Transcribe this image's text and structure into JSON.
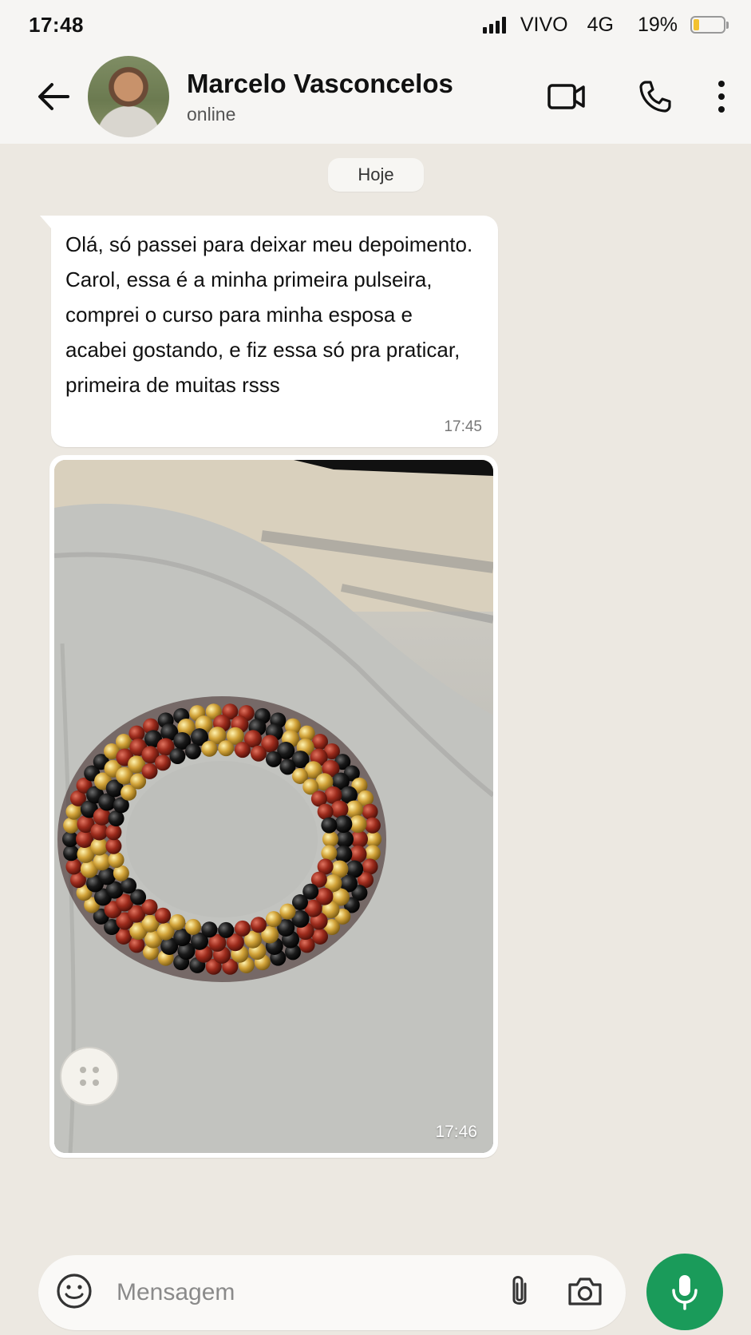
{
  "status_bar": {
    "time": "17:48",
    "carrier": "VIVO",
    "network": "4G",
    "battery": "19%",
    "battery_level": 0.19
  },
  "header": {
    "contact_name": "Marcelo Vasconcelos",
    "contact_status": "online",
    "icons": [
      "back-arrow-icon",
      "video-call-icon",
      "phone-icon",
      "more-vert-icon"
    ]
  },
  "chat": {
    "date_label": "Hoje",
    "messages": [
      {
        "type": "text",
        "text": "Olá, só passei para deixar meu depoimento. Carol, essa é a minha primeira pulseira, comprei o curso para minha esposa e acabei gostando, e fiz essa só pra praticar, primeira de muitas rsss",
        "time": "17:45"
      },
      {
        "type": "image",
        "time": "17:46"
      }
    ]
  },
  "input": {
    "placeholder": "Mensagem",
    "icons": [
      "emoji-icon",
      "attach-icon",
      "camera-icon",
      "mic-icon"
    ]
  },
  "colors": {
    "accent_green": "#1a9b5a",
    "background": "#ece8e1",
    "bubble": "#ffffff",
    "battery_fill": "#f2c12e"
  }
}
